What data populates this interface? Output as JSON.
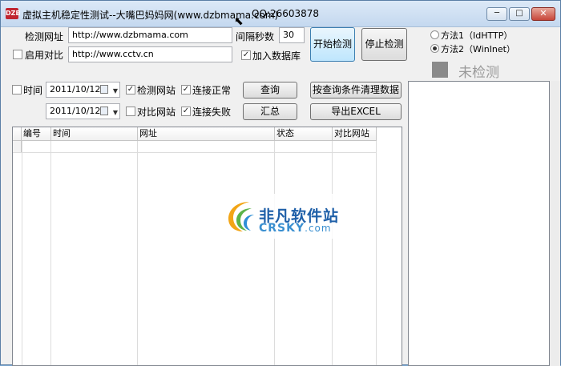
{
  "window": {
    "icon_text": "DZB",
    "title": "虚拟主机稳定性测试--大嘴巴妈妈网(www.dzbmama.com)",
    "qq": "QQ:26603878",
    "minimize": "─",
    "maximize": "□",
    "close": "✕"
  },
  "form": {
    "check_url_label": "检测网址",
    "check_url_value": "http://www.dzbmama.com",
    "interval_label": "间隔秒数",
    "interval_value": "30",
    "enable_compare_label": "启用对比",
    "compare_url_value": "http://www.cctv.cn",
    "add_db_label": "加入数据库",
    "start_button": "开始检测",
    "stop_button": "停止检测"
  },
  "methods": {
    "method1": "方法1（IdHTTP）",
    "method2": "方法2（WinInet）"
  },
  "status": {
    "text": "未检测"
  },
  "filters": {
    "time_label": "时间",
    "date_from": "2011/10/12",
    "date_to": "2011/10/12",
    "check_site_label": "检测网站",
    "compare_site_label": "对比网站",
    "connect_ok_label": "连接正常",
    "connect_fail_label": "连接失败",
    "query_button": "查询",
    "summary_button": "汇总",
    "clear_button": "按查询条件清理数据",
    "export_button": "导出EXCEL"
  },
  "table": {
    "columns": [
      "编号",
      "时间",
      "网址",
      "状态",
      "对比网站"
    ]
  },
  "watermark": {
    "cn": "非凡软件站",
    "en": "CRSKY",
    "en_suffix": ".com"
  }
}
